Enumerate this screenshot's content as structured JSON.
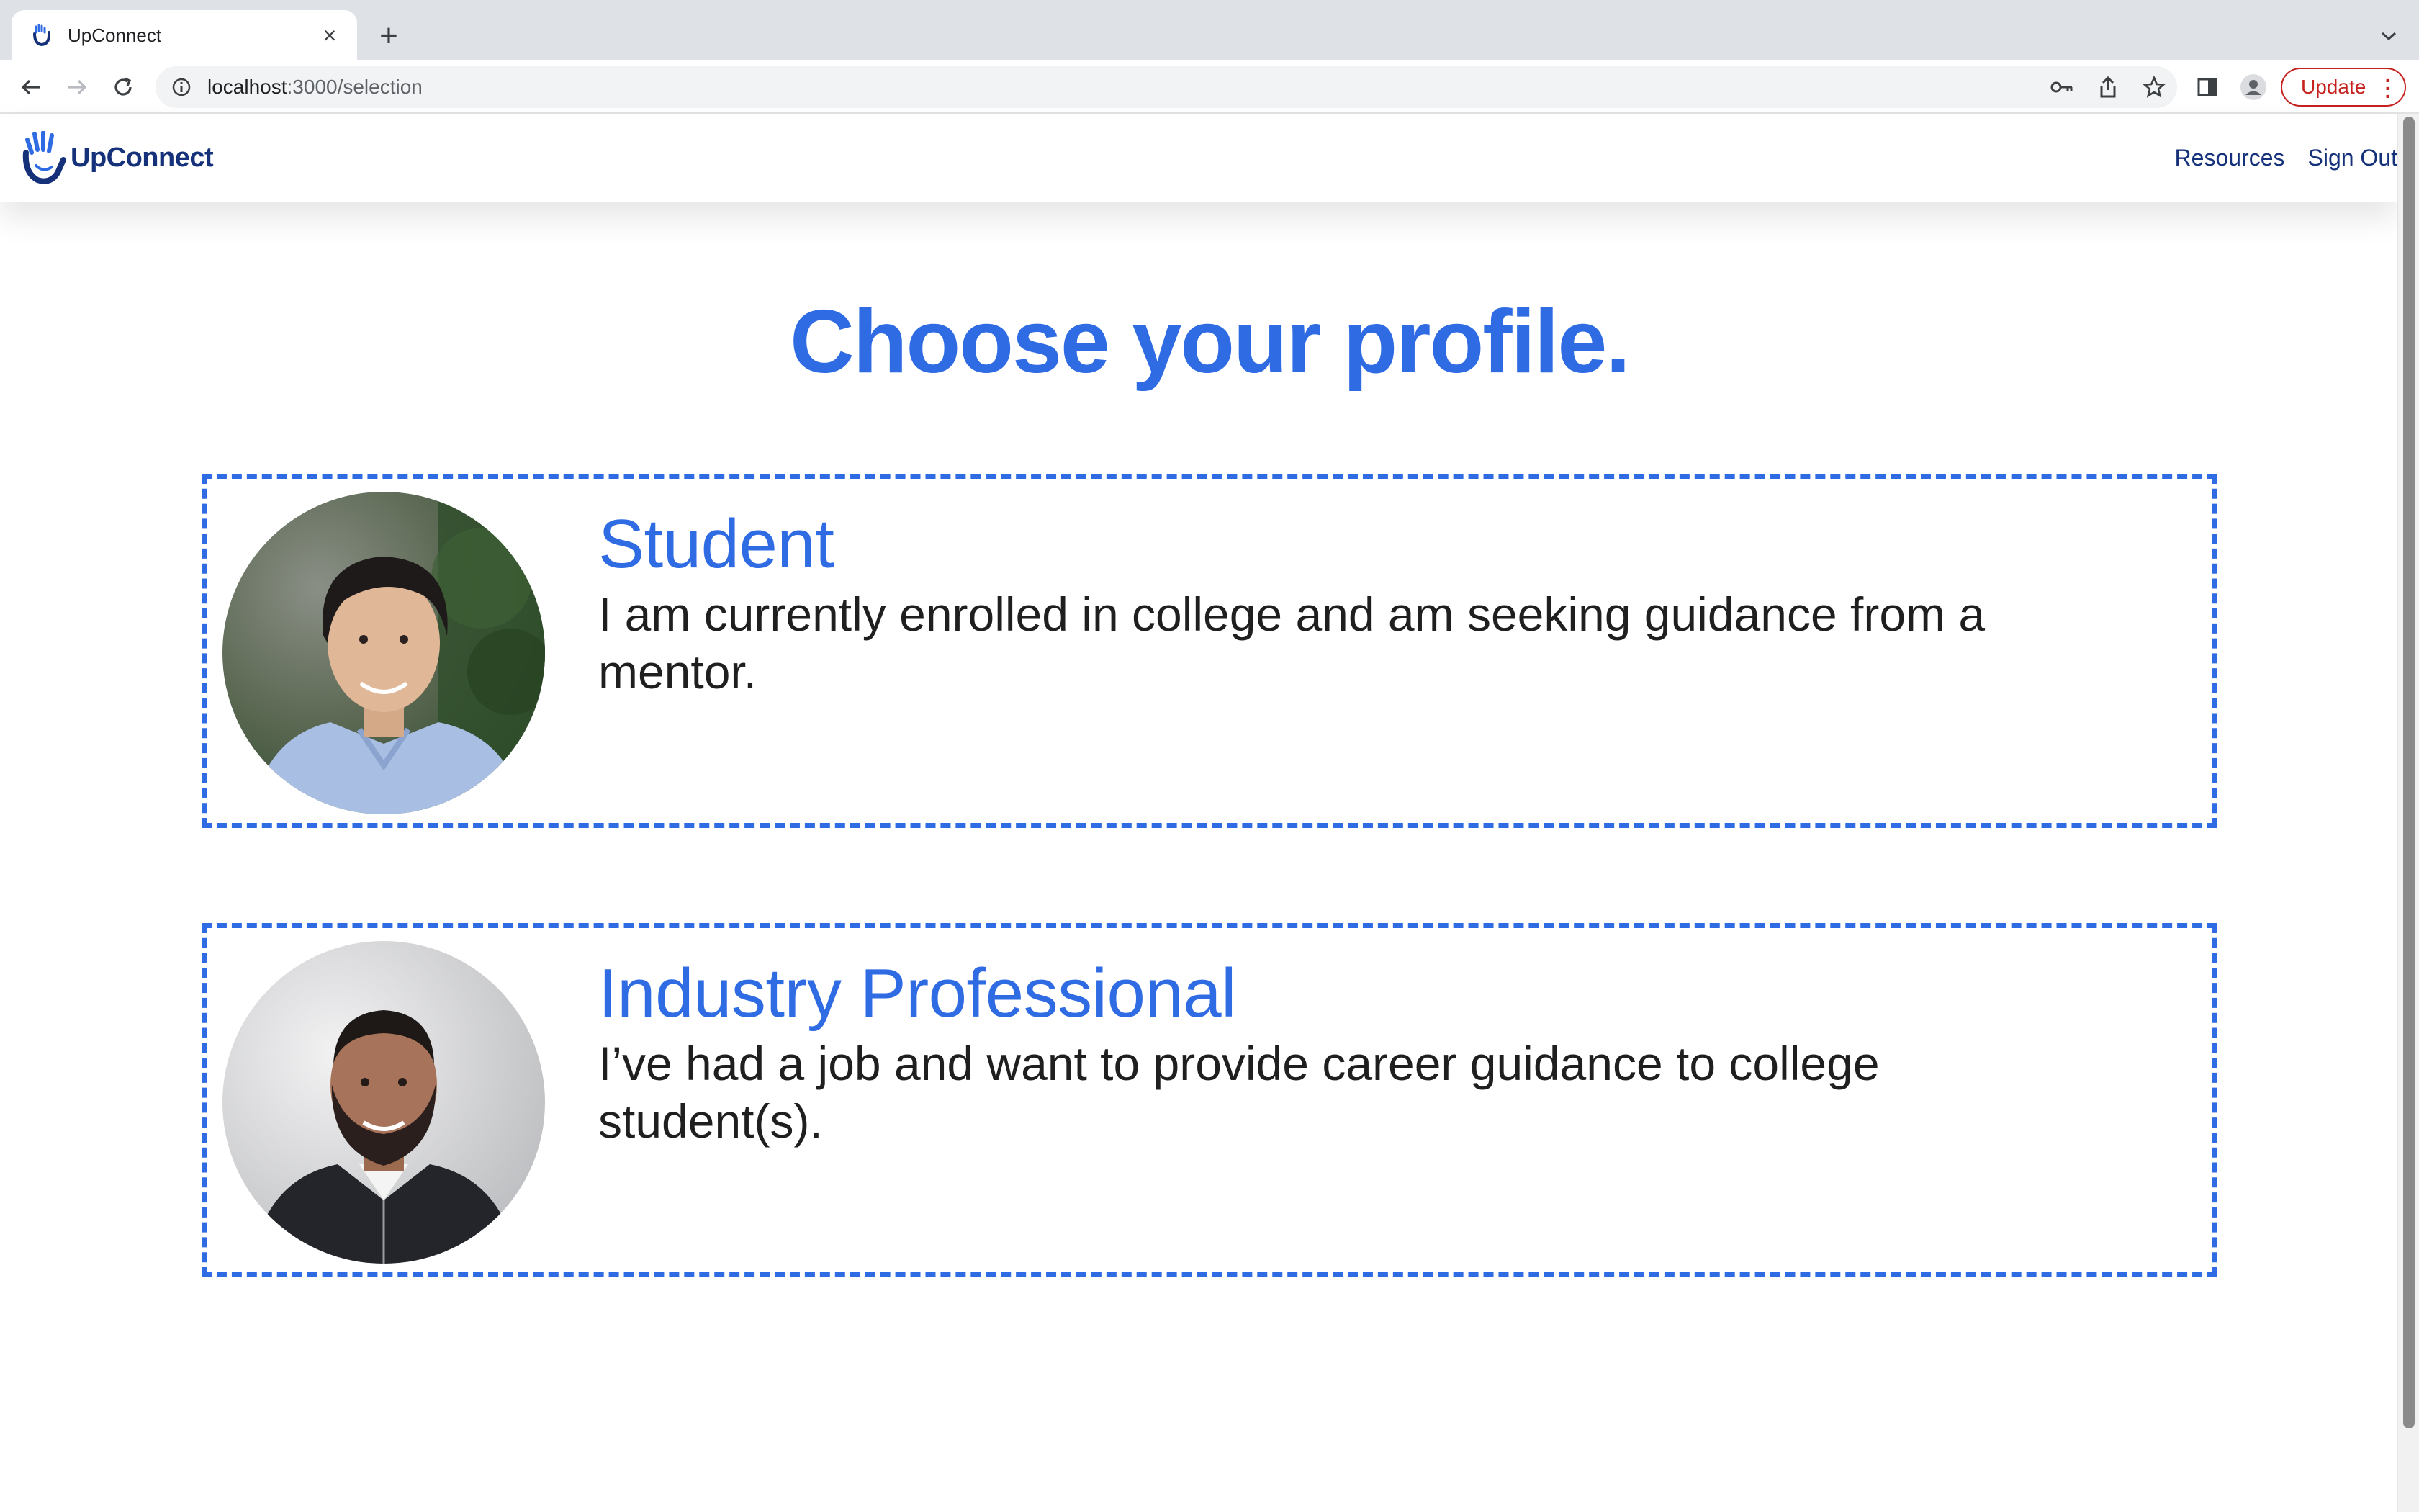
{
  "browser": {
    "tab_title": "UpConnect",
    "url_host": "localhost",
    "url_path": ":3000/selection",
    "update_label": "Update"
  },
  "app": {
    "brand": "UpConnect",
    "nav": [
      {
        "label": "Resources"
      },
      {
        "label": "Sign Out"
      }
    ],
    "heading": "Choose your profile.",
    "profiles": [
      {
        "title": "Student",
        "description": "I am currently enrolled in college and am seeking guidance from a mentor."
      },
      {
        "title": "Industry Professional",
        "description": "I’ve had a job and want to provide career guidance to college student(s)."
      }
    ]
  },
  "colors": {
    "accent": "#2f6be3",
    "brand_navy": "#15317a",
    "update_red": "#c5221f"
  }
}
